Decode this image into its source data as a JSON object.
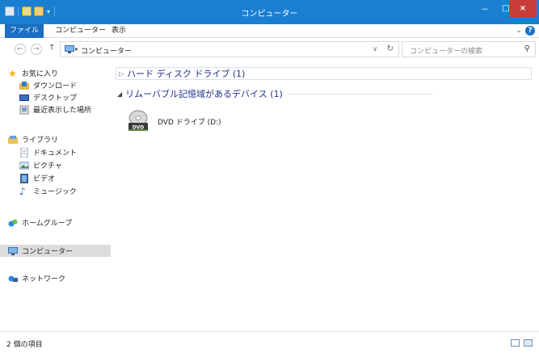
{
  "window": {
    "title": "コンピューター",
    "buttons": {
      "minimize": "－",
      "maximize": "□",
      "close": "×"
    }
  },
  "ribbon": {
    "tabs": [
      "ファイル",
      "コンピューター",
      "表示"
    ],
    "expand_icon": "chevron-down-icon",
    "help_label": "?"
  },
  "address": {
    "back": "←",
    "forward": "→",
    "up": "↑",
    "path": "コンピューター",
    "separator": "▸",
    "search_placeholder": "コンピューターの検索"
  },
  "nav": {
    "favorites": {
      "label": "お気に入り",
      "items": [
        "ダウンロード",
        "デスクトップ",
        "最近表示した場所"
      ]
    },
    "libraries": {
      "label": "ライブラリ",
      "items": [
        "ドキュメント",
        "ピクチャ",
        "ビデオ",
        "ミュージック"
      ]
    },
    "homegroup": "ホームグループ",
    "computer": "コンピューター",
    "network": "ネットワーク"
  },
  "content": {
    "groups": [
      {
        "label": "ハード ディスク ドライブ (1)",
        "collapsed": true
      },
      {
        "label": "リムーバブル記憶域があるデバイス (1)",
        "collapsed": false
      }
    ],
    "devices": [
      {
        "label": "DVD ドライブ (D:)",
        "icon_text": "DVD"
      }
    ]
  },
  "status": {
    "count": "2 個の項目"
  },
  "colors": {
    "titlebar": "#1b7fd1",
    "close": "#c73b3b",
    "accent": "#1b6ec2"
  }
}
